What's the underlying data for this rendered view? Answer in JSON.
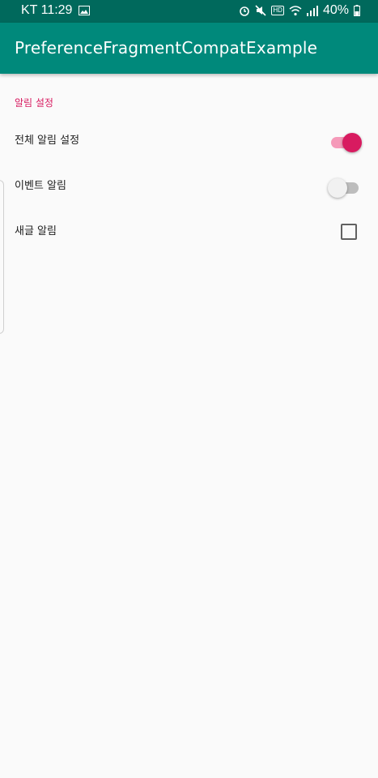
{
  "status_bar": {
    "carrier_time": "KT 11:29",
    "battery": "40%",
    "hd": "HD",
    "icons": [
      "image-icon",
      "alarm-icon",
      "mute-icon",
      "hd-icon",
      "wifi-icon",
      "signal-icon",
      "battery-icon"
    ]
  },
  "app_bar": {
    "title": "PreferenceFragmentCompatExample"
  },
  "preferences": {
    "category": "알림 설정",
    "items": [
      {
        "label": "전체 알림 설정",
        "type": "switch",
        "checked": true
      },
      {
        "label": "이벤트 알림",
        "type": "switch",
        "checked": false
      },
      {
        "label": "새글 알림",
        "type": "checkbox",
        "checked": false
      }
    ]
  },
  "colors": {
    "status_bar": "#00695c",
    "app_bar": "#00897b",
    "accent": "#d81b60",
    "background": "#fafafa"
  }
}
